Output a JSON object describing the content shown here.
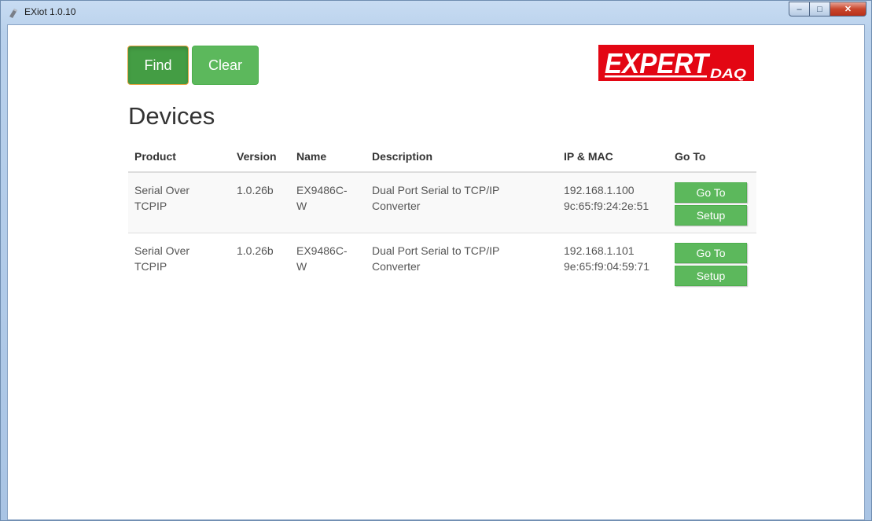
{
  "window": {
    "title": "EXiot 1.0.10"
  },
  "toolbar": {
    "find_label": "Find",
    "clear_label": "Clear"
  },
  "logo": {
    "text_main": "EXPERT",
    "text_sub": "DAQ"
  },
  "page": {
    "heading": "Devices"
  },
  "table": {
    "headers": {
      "product": "Product",
      "version": "Version",
      "name": "Name",
      "description": "Description",
      "ip_mac": "IP & MAC",
      "goto": "Go To"
    },
    "rows": [
      {
        "product_1": "Serial Over",
        "product_2": "TCPIP",
        "version": "1.0.26b",
        "name_1": "EX9486C-",
        "name_2": "W",
        "desc_1": "Dual Port Serial to TCP/IP",
        "desc_2": "Converter",
        "ip": "192.168.1.100",
        "mac": "9c:65:f9:24:2e:51",
        "goto_label": "Go To",
        "setup_label": "Setup"
      },
      {
        "product_1": "Serial Over",
        "product_2": "TCPIP",
        "version": "1.0.26b",
        "name_1": "EX9486C-",
        "name_2": "W",
        "desc_1": "Dual Port Serial to TCP/IP",
        "desc_2": "Converter",
        "ip": "192.168.1.101",
        "mac": "9e:65:f9:04:59:71",
        "goto_label": "Go To",
        "setup_label": "Setup"
      }
    ]
  },
  "colors": {
    "button_green": "#5cb85c",
    "button_green_active": "#449d44",
    "logo_red": "#e30613"
  }
}
